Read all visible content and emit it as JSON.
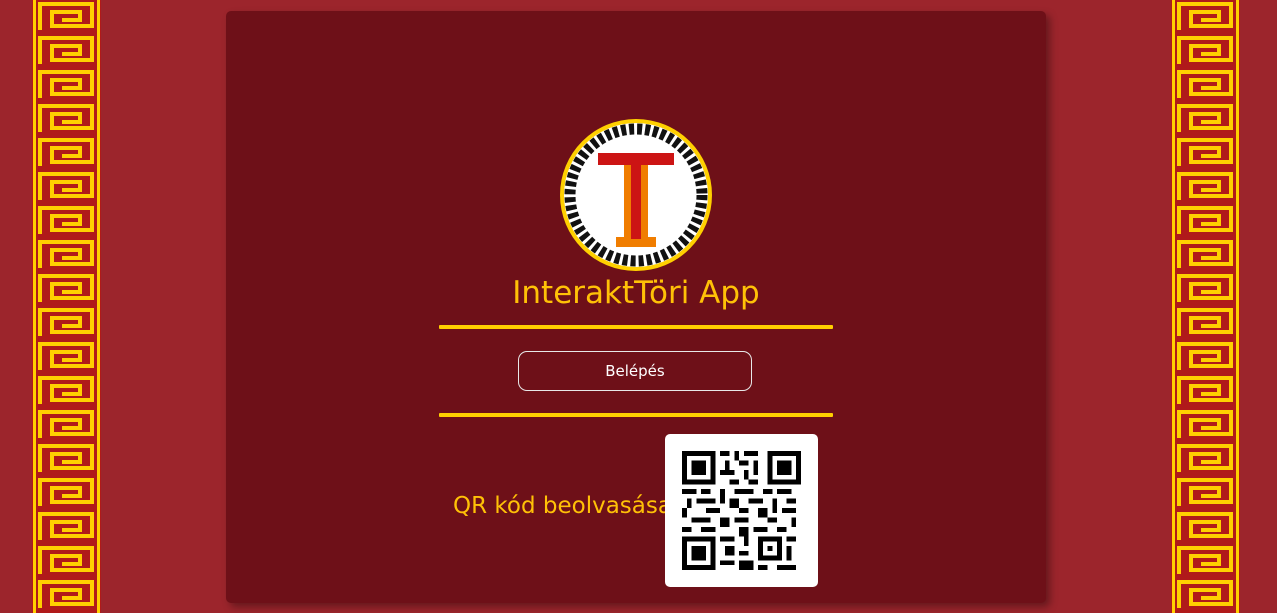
{
  "app": {
    "title": "InteraktTöri App",
    "logo_icon": "column-t-logo-icon"
  },
  "login": {
    "button_label": "Belépés"
  },
  "qr": {
    "label": "QR kód beolvasása:",
    "icon": "qr-code-icon"
  },
  "colors": {
    "background": "#9c252c",
    "card": "#6e1018",
    "accent": "#ffc107",
    "divider": "#ffd000",
    "border_pattern": "#ffd000"
  },
  "decor": {
    "left_border": "greek-key-border",
    "right_border": "greek-key-border"
  }
}
